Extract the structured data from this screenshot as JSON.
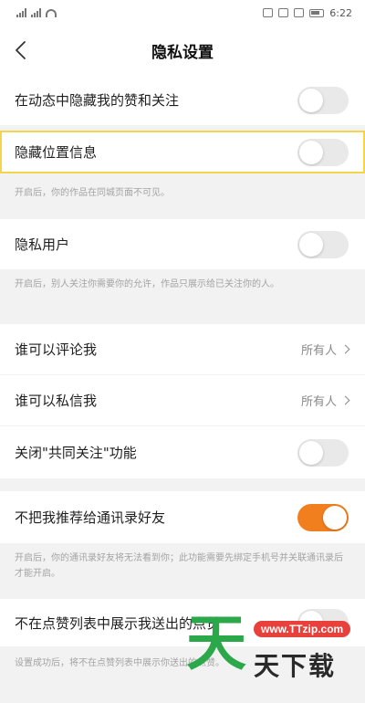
{
  "status_bar": {
    "time": "6:22"
  },
  "header": {
    "title": "隐私设置"
  },
  "rows": {
    "hide_likes": {
      "label": "在动态中隐藏我的赞和关注",
      "on": false
    },
    "hide_location": {
      "label": "隐藏位置信息",
      "on": false
    },
    "private_user": {
      "label": "隐私用户",
      "on": false
    },
    "who_comment": {
      "label": "谁可以评论我",
      "value": "所有人"
    },
    "who_message": {
      "label": "谁可以私信我",
      "value": "所有人"
    },
    "close_common": {
      "label": "关闭\"共同关注\"功能",
      "on": false
    },
    "no_recommend": {
      "label": "不把我推荐给通讯录好友",
      "on": true
    },
    "hide_likes_list": {
      "label": "不在点赞列表中展示我送出的点赞",
      "on": false
    }
  },
  "notes": {
    "location": "开启后，你的作品在同城页面不可见。",
    "private": "开启后，别人关注你需要你的允许，作品只展示给已关注你的人。",
    "recommend": "开启后，你的通讯录好友将无法看到你；此功能需要先绑定手机号并关联通讯录后才能开启。",
    "likes_list": "设置成功后，将不在点赞列表中展示你送出的点赞。"
  },
  "watermark": {
    "big_char": "天",
    "url": "www.TTzip.com",
    "name": "天下载"
  },
  "colors": {
    "accent": "#f27f1d",
    "highlight": "#f3d44a"
  }
}
